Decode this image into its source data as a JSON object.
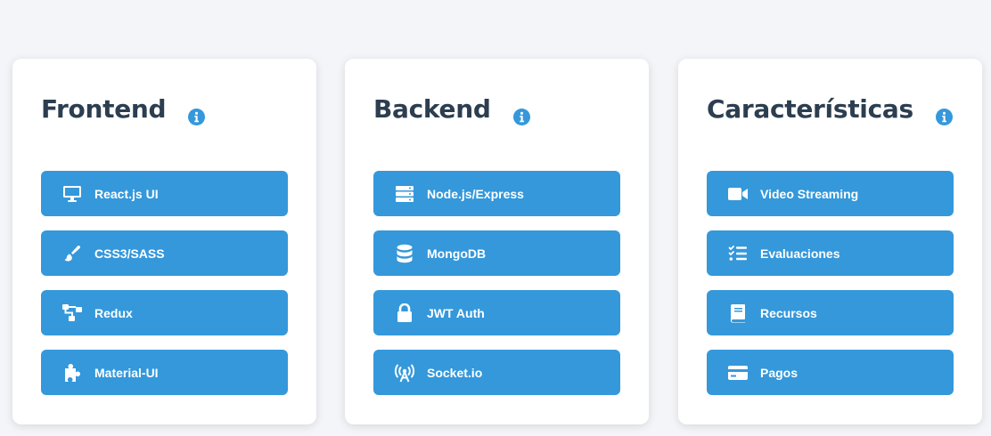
{
  "colors": {
    "background": "#f4f5f9",
    "card": "#ffffff",
    "title": "#2c3e50",
    "accent": "#3498db",
    "button_text": "#ffffff"
  },
  "cards": [
    {
      "title": "Frontend",
      "info_icon": "info-circle-icon",
      "items": [
        {
          "label": "React.js UI",
          "icon": "monitor-icon"
        },
        {
          "label": "CSS3/SASS",
          "icon": "paintbrush-icon"
        },
        {
          "label": "Redux",
          "icon": "sitemap-icon"
        },
        {
          "label": "Material-UI",
          "icon": "puzzle-icon"
        }
      ]
    },
    {
      "title": "Backend",
      "info_icon": "info-circle-icon",
      "items": [
        {
          "label": "Node.js/Express",
          "icon": "server-icon"
        },
        {
          "label": "MongoDB",
          "icon": "database-icon"
        },
        {
          "label": "JWT Auth",
          "icon": "lock-icon"
        },
        {
          "label": "Socket.io",
          "icon": "broadcast-tower-icon"
        }
      ]
    },
    {
      "title": "Características",
      "info_icon": "info-circle-icon",
      "items": [
        {
          "label": "Video Streaming",
          "icon": "video-camera-icon"
        },
        {
          "label": "Evaluaciones",
          "icon": "checklist-icon"
        },
        {
          "label": "Recursos",
          "icon": "book-icon"
        },
        {
          "label": "Pagos",
          "icon": "credit-card-icon"
        }
      ]
    }
  ]
}
